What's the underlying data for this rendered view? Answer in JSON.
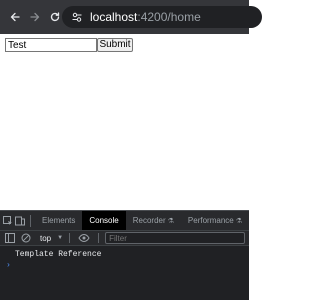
{
  "browser": {
    "url_host": "localhost",
    "url_path": ":4200/home"
  },
  "form": {
    "input_value": "Test",
    "submit_label": "Submit"
  },
  "devtools": {
    "tabs": [
      "Elements",
      "Console",
      "Recorder",
      "Performance"
    ],
    "active_tab": "Console",
    "context": "top",
    "filter_placeholder": "Filter",
    "log_message": "Template Reference",
    "prompt_symbol": "›"
  },
  "colors": {
    "browser_chrome": "#35363a",
    "devtools_bg": "#202124",
    "link_blue": "#4e8cf0"
  }
}
